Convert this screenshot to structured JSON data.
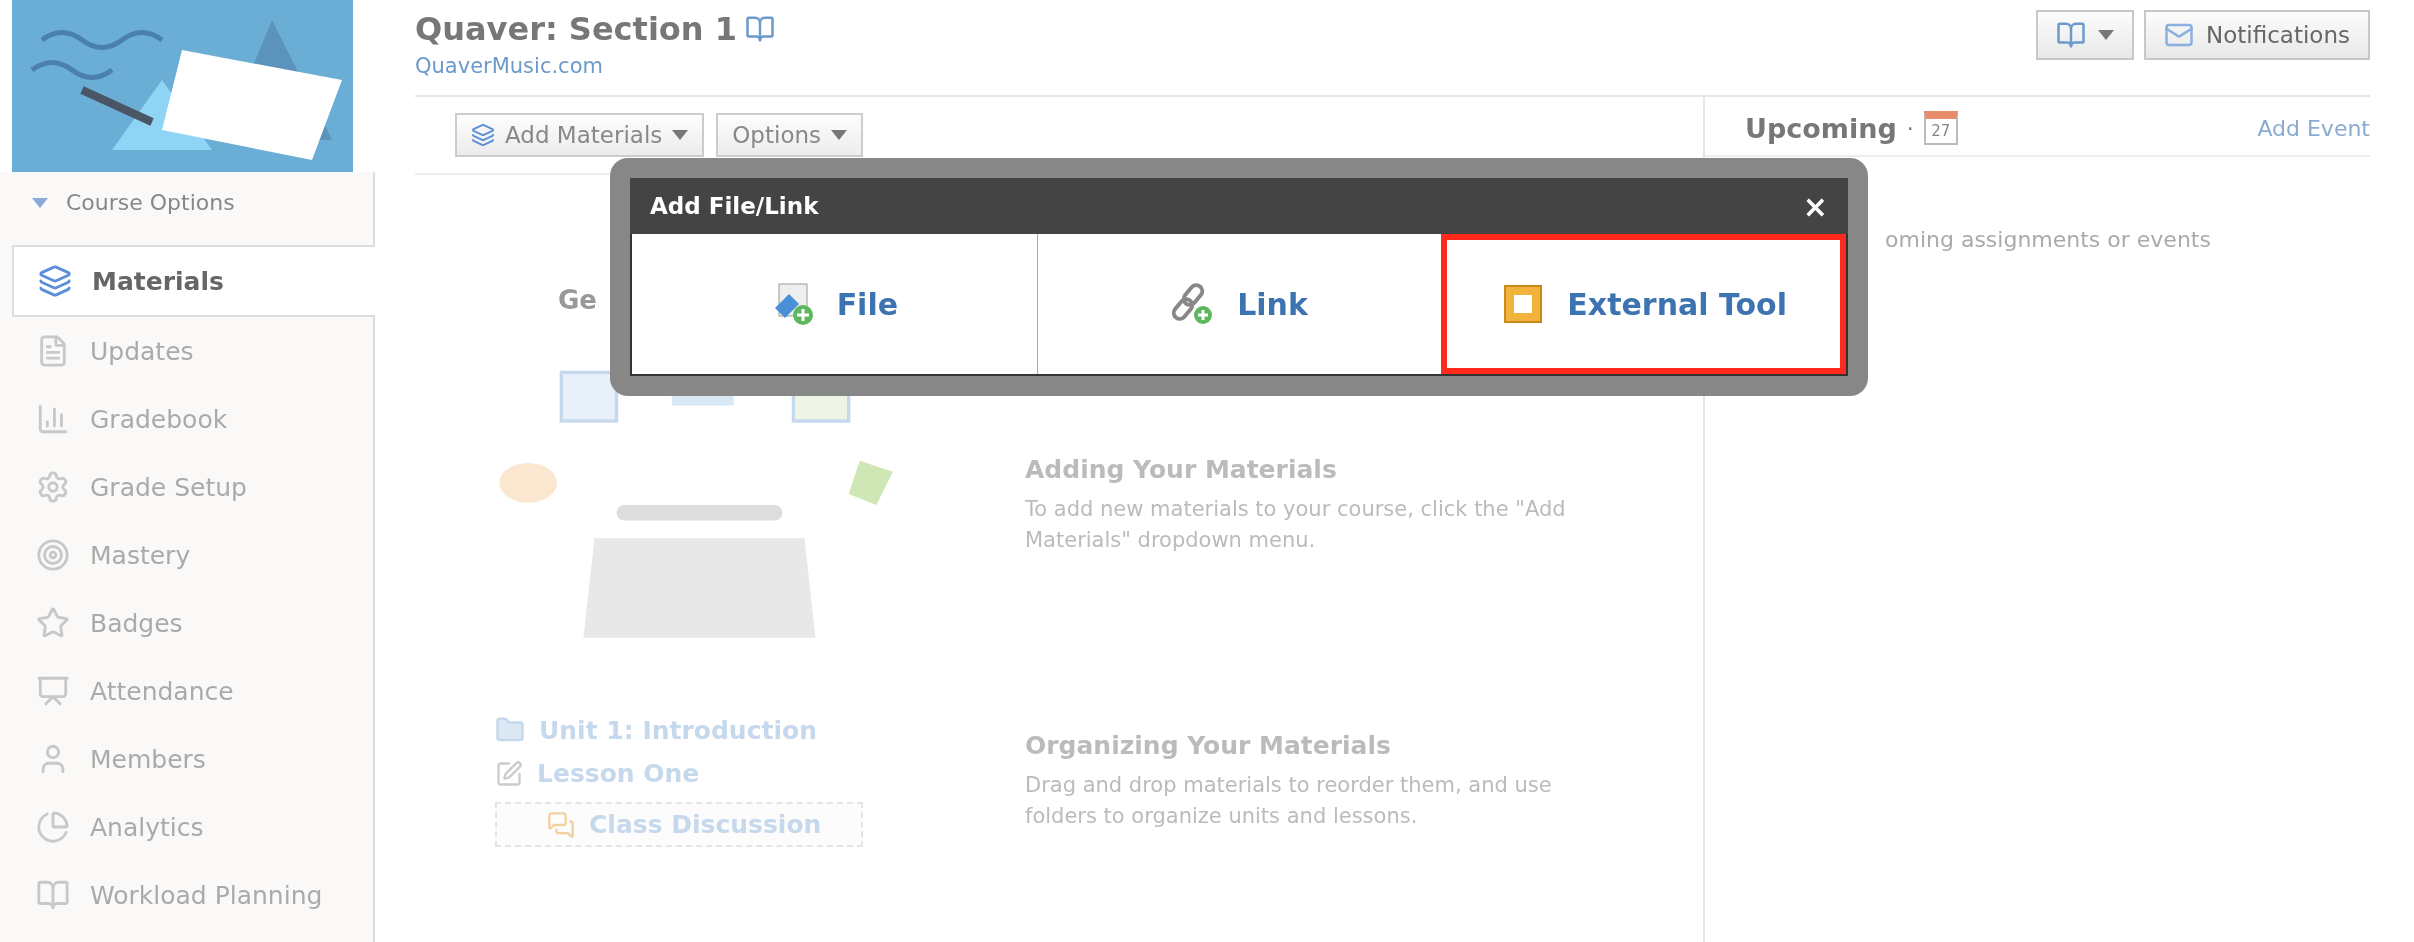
{
  "course": {
    "title": "Quaver: Section 1",
    "link": "QuaverMusic.com"
  },
  "sidebar": {
    "course_options": "Course Options",
    "items": [
      {
        "label": "Materials",
        "selected": true
      },
      {
        "label": "Updates",
        "selected": false
      },
      {
        "label": "Gradebook",
        "selected": false
      },
      {
        "label": "Grade Setup",
        "selected": false
      },
      {
        "label": "Mastery",
        "selected": false
      },
      {
        "label": "Badges",
        "selected": false
      },
      {
        "label": "Attendance",
        "selected": false
      },
      {
        "label": "Members",
        "selected": false
      },
      {
        "label": "Analytics",
        "selected": false
      },
      {
        "label": "Workload Planning",
        "selected": false
      }
    ]
  },
  "header_buttons": {
    "notifications": "Notifications"
  },
  "toolbar": [
    "Add Materials",
    "Options"
  ],
  "materials": {
    "heading": "Ge",
    "sections": [
      {
        "title": "Adding Your Materials",
        "text": "To add new materials to your course, click the \"Add Materials\" dropdown menu."
      },
      {
        "title": "Organizing Your Materials",
        "text": "Drag and drop materials to reorder them, and use folders to organize units and lessons."
      }
    ],
    "sample": [
      {
        "kind": "folder",
        "label": "Unit 1: Introduction"
      },
      {
        "kind": "lesson",
        "label": "Lesson One"
      },
      {
        "kind": "discussion",
        "label": "Class Discussion"
      }
    ]
  },
  "upcoming": {
    "title": "Upcoming",
    "separator": "·",
    "calendar_day": "27",
    "add": "Add Event",
    "empty": "oming assignments or events"
  },
  "modal": {
    "title": "Add File/Link",
    "close": "×",
    "options": [
      {
        "kind": "file",
        "label": "File",
        "highlighted": false
      },
      {
        "kind": "link",
        "label": "Link",
        "highlighted": false
      },
      {
        "kind": "tool",
        "label": "External Tool",
        "highlighted": true
      }
    ]
  }
}
